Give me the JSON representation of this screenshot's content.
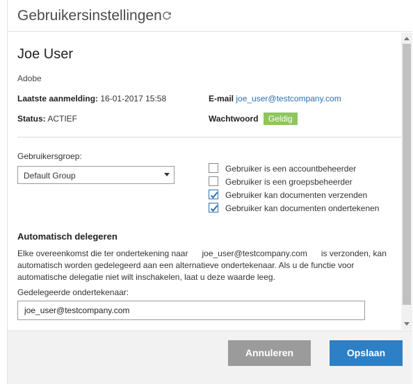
{
  "header": {
    "title": "Gebruikersinstellingen",
    "refresh_icon": "refresh-icon"
  },
  "user": {
    "name": "Joe User",
    "organization": "Adobe"
  },
  "fields": {
    "last_login_label": "Laatste aanmelding:",
    "last_login_value": "16-01-2017 15:58",
    "email_label": "E-mail",
    "email_value": "joe_user@testcompany.com",
    "status_label": "Status:",
    "status_value": "ACTIEF",
    "password_label": "Wachtwoord",
    "password_value": "Geldig"
  },
  "group": {
    "label": "Gebruikersgroep:",
    "selected": "Default Group"
  },
  "permissions": [
    {
      "label": "Gebruiker is een accountbeheerder",
      "checked": false
    },
    {
      "label": "Gebruiker is een groepsbeheerder",
      "checked": false
    },
    {
      "label": "Gebruiker kan documenten verzenden",
      "checked": true
    },
    {
      "label": "Gebruiker kan documenten ondertekenen",
      "checked": true
    }
  ],
  "delegation": {
    "title": "Automatisch delegeren",
    "text_before": "Elke overeenkomst die ter ondertekening naar",
    "email": "joe_user@testcompany.com",
    "text_after": "is verzonden, kan automatisch worden gedelegeerd aan een alternatieve ondertekenaar. Als u de functie voor automatische delegatie niet wilt inschakelen, laat u deze waarde leeg.",
    "signer_label": "Gedelegeerde ondertekenaar:",
    "signer_value": "joe_user@testcompany.com"
  },
  "footer": {
    "cancel_label": "Annuleren",
    "save_label": "Opslaan"
  },
  "colors": {
    "accent": "#2d7fc6",
    "badge": "#8fc55f",
    "cancel": "#9b9b9b"
  }
}
